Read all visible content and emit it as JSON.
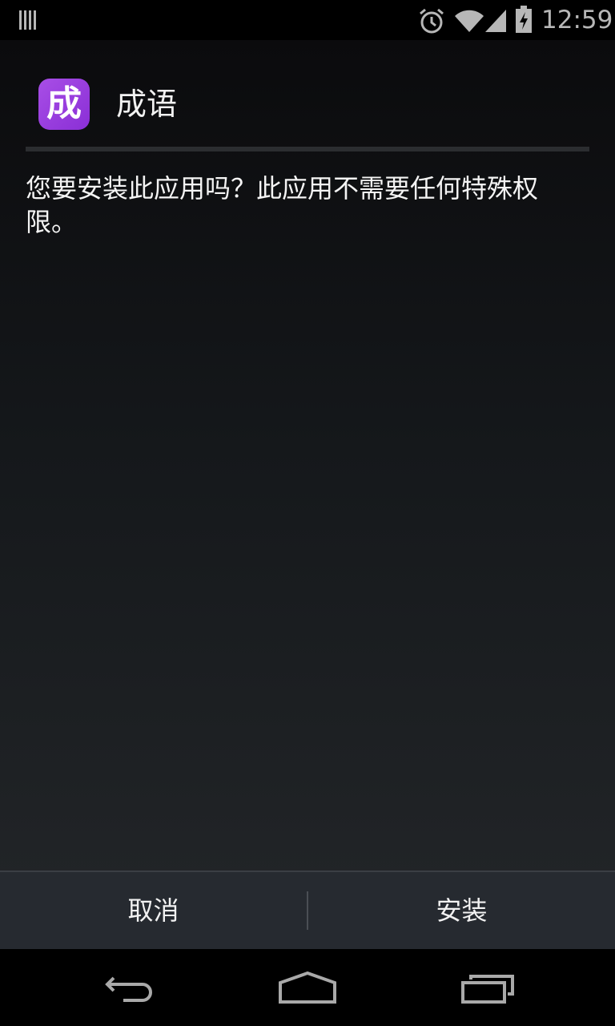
{
  "status_bar": {
    "time": "12:59",
    "icons": [
      "notification-bars-icon",
      "alarm-icon",
      "wifi-icon",
      "signal-icon",
      "battery-charging-icon"
    ]
  },
  "app": {
    "icon_glyph": "成",
    "title": "成语",
    "message": "您要安装此应用吗？此应用不需要任何特殊权限。",
    "icon_color": "#9b3fe0"
  },
  "buttons": {
    "cancel": "取消",
    "install": "安装"
  },
  "nav_bar": {
    "icons": [
      "back-icon",
      "home-icon",
      "recent-apps-icon"
    ]
  }
}
